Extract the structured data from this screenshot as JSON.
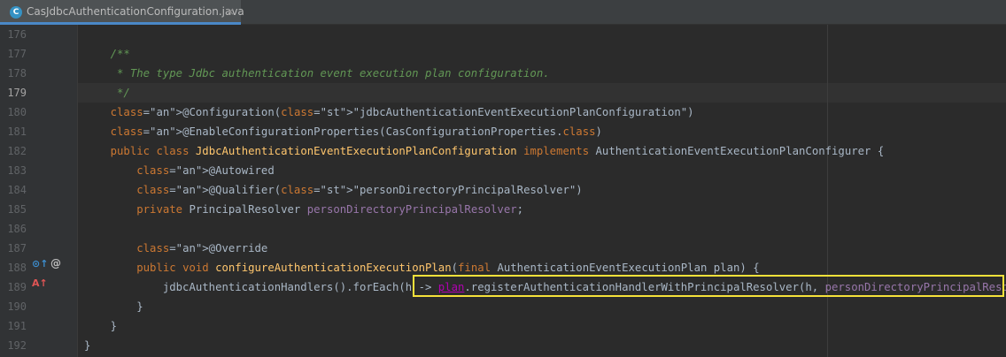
{
  "tab": {
    "icon": "C",
    "filename": "CasJdbcAuthenticationConfiguration.java",
    "close": "×"
  },
  "gutter_icons": {
    "override_marker": "⊙↑",
    "at_marker": "@",
    "implements_marker": "A↑"
  },
  "lines": [
    {
      "num": "176",
      "text": ""
    },
    {
      "num": "177",
      "text": "    /**"
    },
    {
      "num": "178",
      "text": "     * The type Jdbc authentication event execution plan configuration."
    },
    {
      "num": "179",
      "text": "     */"
    },
    {
      "num": "180",
      "text": "    @Configuration(\"jdbcAuthenticationEventExecutionPlanConfiguration\")"
    },
    {
      "num": "181",
      "text": "    @EnableConfigurationProperties(CasConfigurationProperties.class)"
    },
    {
      "num": "182",
      "text": "    public class JdbcAuthenticationEventExecutionPlanConfiguration implements AuthenticationEventExecutionPlanConfigurer {"
    },
    {
      "num": "183",
      "text": "        @Autowired"
    },
    {
      "num": "184",
      "text": "        @Qualifier(\"personDirectoryPrincipalResolver\")"
    },
    {
      "num": "185",
      "text": "        private PrincipalResolver personDirectoryPrincipalResolver;"
    },
    {
      "num": "186",
      "text": ""
    },
    {
      "num": "187",
      "text": "        @Override"
    },
    {
      "num": "188",
      "text": "        public void configureAuthenticationExecutionPlan(final AuthenticationEventExecutionPlan plan) {"
    },
    {
      "num": "189",
      "text": "            jdbcAuthenticationHandlers().forEach(h -> plan.registerAuthenticationHandlerWithPrincipalResolver(h, personDirectoryPrincipalResolver));"
    },
    {
      "num": "190",
      "text": "        }"
    },
    {
      "num": "191",
      "text": "    }"
    },
    {
      "num": "192",
      "text": "}"
    }
  ],
  "colors": {
    "background": "#2b2b2b",
    "highlight_box": "#f6e13a",
    "keyword": "#cc7832",
    "annotation": "#bbb529",
    "string": "#6a8759",
    "comment": "#629755",
    "method": "#ffc66d",
    "field": "#9876aa"
  }
}
